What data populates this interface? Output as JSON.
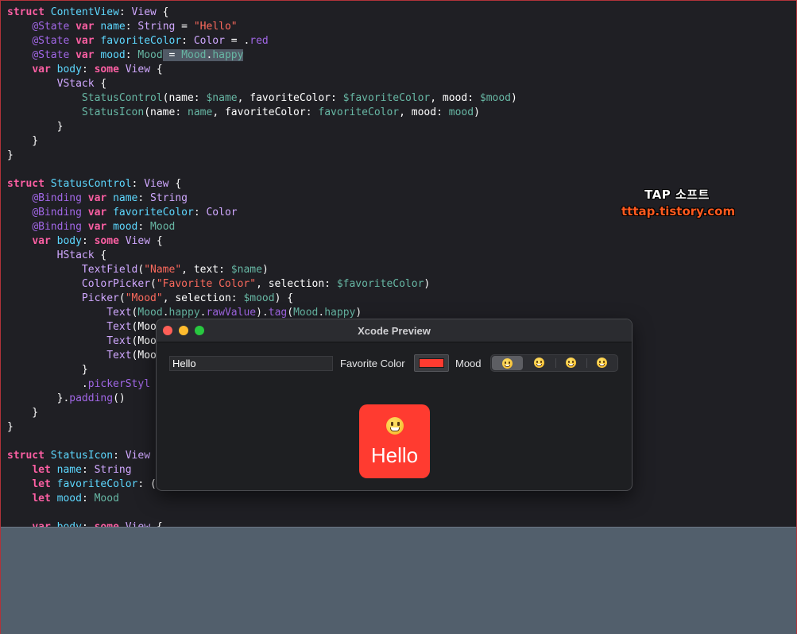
{
  "colors": {
    "keyword": "#fc5fa3",
    "type": "#5dd8ff",
    "property": "#67b7a4",
    "string": "#fc6a5d",
    "function": "#a167e6",
    "favorite_color": "#ff3b30",
    "bottom_panel": "#525f6c"
  },
  "code_lines": [
    [
      [
        "kw",
        "struct"
      ],
      [
        "pl",
        " "
      ],
      [
        "ty",
        "ContentView"
      ],
      [
        "pl",
        ": "
      ],
      [
        "ty2",
        "View"
      ],
      [
        "pl",
        " {"
      ]
    ],
    [
      [
        "pl",
        "    "
      ],
      [
        "fn",
        "@State"
      ],
      [
        "pl",
        " "
      ],
      [
        "kw",
        "var"
      ],
      [
        "pl",
        " "
      ],
      [
        "ty",
        "name"
      ],
      [
        "pl",
        ": "
      ],
      [
        "ty2",
        "String"
      ],
      [
        "pl",
        " = "
      ],
      [
        "str",
        "\"Hello\""
      ]
    ],
    [
      [
        "pl",
        "    "
      ],
      [
        "fn",
        "@State"
      ],
      [
        "pl",
        " "
      ],
      [
        "kw",
        "var"
      ],
      [
        "pl",
        " "
      ],
      [
        "ty",
        "favoriteColor"
      ],
      [
        "pl",
        ": "
      ],
      [
        "ty2",
        "Color"
      ],
      [
        "pl",
        " = ."
      ],
      [
        "fn",
        "red"
      ]
    ],
    [
      [
        "pl",
        "    "
      ],
      [
        "fn",
        "@State"
      ],
      [
        "pl",
        " "
      ],
      [
        "kw",
        "var"
      ],
      [
        "pl",
        " "
      ],
      [
        "ty",
        "mood"
      ],
      [
        "pl",
        ": "
      ],
      [
        "prop",
        "Mood"
      ],
      [
        "sel",
        " = "
      ],
      [
        "selprop",
        "Mood"
      ],
      [
        "sel",
        "."
      ],
      [
        "selprop2",
        "happy"
      ]
    ],
    [
      [
        "pl",
        "    "
      ],
      [
        "kw",
        "var"
      ],
      [
        "pl",
        " "
      ],
      [
        "ty",
        "body"
      ],
      [
        "pl",
        ": "
      ],
      [
        "kw",
        "some"
      ],
      [
        "pl",
        " "
      ],
      [
        "ty2",
        "View"
      ],
      [
        "pl",
        " {"
      ]
    ],
    [
      [
        "pl",
        "        "
      ],
      [
        "ty2",
        "VStack"
      ],
      [
        "pl",
        " {"
      ]
    ],
    [
      [
        "pl",
        "            "
      ],
      [
        "prop",
        "StatusControl"
      ],
      [
        "pl",
        "(name: "
      ],
      [
        "prop",
        "$name"
      ],
      [
        "pl",
        ", favoriteColor: "
      ],
      [
        "prop",
        "$favoriteColor"
      ],
      [
        "pl",
        ", mood: "
      ],
      [
        "prop",
        "$mood"
      ],
      [
        "pl",
        ")"
      ]
    ],
    [
      [
        "pl",
        "            "
      ],
      [
        "prop",
        "StatusIcon"
      ],
      [
        "pl",
        "(name: "
      ],
      [
        "prop",
        "name"
      ],
      [
        "pl",
        ", favoriteColor: "
      ],
      [
        "prop",
        "favoriteColor"
      ],
      [
        "pl",
        ", mood: "
      ],
      [
        "prop",
        "mood"
      ],
      [
        "pl",
        ")"
      ]
    ],
    [
      [
        "pl",
        "        }"
      ]
    ],
    [
      [
        "pl",
        "    }"
      ]
    ],
    [
      [
        "pl",
        "}"
      ]
    ],
    [
      [
        "pl",
        ""
      ]
    ],
    [
      [
        "kw",
        "struct"
      ],
      [
        "pl",
        " "
      ],
      [
        "ty",
        "StatusControl"
      ],
      [
        "pl",
        ": "
      ],
      [
        "ty2",
        "View"
      ],
      [
        "pl",
        " {"
      ]
    ],
    [
      [
        "pl",
        "    "
      ],
      [
        "fn",
        "@Binding"
      ],
      [
        "pl",
        " "
      ],
      [
        "kw",
        "var"
      ],
      [
        "pl",
        " "
      ],
      [
        "ty",
        "name"
      ],
      [
        "pl",
        ": "
      ],
      [
        "ty2",
        "String"
      ]
    ],
    [
      [
        "pl",
        "    "
      ],
      [
        "fn",
        "@Binding"
      ],
      [
        "pl",
        " "
      ],
      [
        "kw",
        "var"
      ],
      [
        "pl",
        " "
      ],
      [
        "ty",
        "favoriteColor"
      ],
      [
        "pl",
        ": "
      ],
      [
        "ty2",
        "Color"
      ]
    ],
    [
      [
        "pl",
        "    "
      ],
      [
        "fn",
        "@Binding"
      ],
      [
        "pl",
        " "
      ],
      [
        "kw",
        "var"
      ],
      [
        "pl",
        " "
      ],
      [
        "ty",
        "mood"
      ],
      [
        "pl",
        ": "
      ],
      [
        "prop",
        "Mood"
      ]
    ],
    [
      [
        "pl",
        "    "
      ],
      [
        "kw",
        "var"
      ],
      [
        "pl",
        " "
      ],
      [
        "ty",
        "body"
      ],
      [
        "pl",
        ": "
      ],
      [
        "kw",
        "some"
      ],
      [
        "pl",
        " "
      ],
      [
        "ty2",
        "View"
      ],
      [
        "pl",
        " {"
      ]
    ],
    [
      [
        "pl",
        "        "
      ],
      [
        "ty2",
        "HStack"
      ],
      [
        "pl",
        " {"
      ]
    ],
    [
      [
        "pl",
        "            "
      ],
      [
        "ty2",
        "TextField"
      ],
      [
        "pl",
        "("
      ],
      [
        "str",
        "\"Name\""
      ],
      [
        "pl",
        ", text: "
      ],
      [
        "prop",
        "$name"
      ],
      [
        "pl",
        ")"
      ]
    ],
    [
      [
        "pl",
        "            "
      ],
      [
        "ty2",
        "ColorPicker"
      ],
      [
        "pl",
        "("
      ],
      [
        "str",
        "\"Favorite Color\""
      ],
      [
        "pl",
        ", selection: "
      ],
      [
        "prop",
        "$favoriteColor"
      ],
      [
        "pl",
        ")"
      ]
    ],
    [
      [
        "pl",
        "            "
      ],
      [
        "ty2",
        "Picker"
      ],
      [
        "pl",
        "("
      ],
      [
        "str",
        "\"Mood\""
      ],
      [
        "pl",
        ", selection: "
      ],
      [
        "prop",
        "$mood"
      ],
      [
        "pl",
        ") {"
      ]
    ],
    [
      [
        "pl",
        "                "
      ],
      [
        "ty2",
        "Text"
      ],
      [
        "pl",
        "("
      ],
      [
        "prop",
        "Mood"
      ],
      [
        "pl",
        "."
      ],
      [
        "prop",
        "happy"
      ],
      [
        "pl",
        "."
      ],
      [
        "fn",
        "rawValue"
      ],
      [
        "pl",
        ")."
      ],
      [
        "fn",
        "tag"
      ],
      [
        "pl",
        "("
      ],
      [
        "prop",
        "Mood"
      ],
      [
        "pl",
        "."
      ],
      [
        "prop",
        "happy"
      ],
      [
        "pl",
        ")"
      ]
    ],
    [
      [
        "pl",
        "                "
      ],
      [
        "ty2",
        "Text"
      ],
      [
        "pl",
        "(Moo"
      ]
    ],
    [
      [
        "pl",
        "                "
      ],
      [
        "ty2",
        "Text"
      ],
      [
        "pl",
        "(Moo"
      ]
    ],
    [
      [
        "pl",
        "                "
      ],
      [
        "ty2",
        "Text"
      ],
      [
        "pl",
        "(Moo"
      ]
    ],
    [
      [
        "pl",
        "            }"
      ]
    ],
    [
      [
        "pl",
        "            ."
      ],
      [
        "fn",
        "pickerStyl"
      ]
    ],
    [
      [
        "pl",
        "        }."
      ],
      [
        "fn",
        "padding"
      ],
      [
        "pl",
        "()"
      ]
    ],
    [
      [
        "pl",
        "    }"
      ]
    ],
    [
      [
        "pl",
        "}"
      ]
    ],
    [
      [
        "pl",
        ""
      ]
    ],
    [
      [
        "kw",
        "struct"
      ],
      [
        "pl",
        " "
      ],
      [
        "ty",
        "StatusIcon"
      ],
      [
        "pl",
        ": "
      ],
      [
        "ty2",
        "View"
      ]
    ],
    [
      [
        "pl",
        "    "
      ],
      [
        "kw",
        "let"
      ],
      [
        "pl",
        " "
      ],
      [
        "ty",
        "name"
      ],
      [
        "pl",
        ": "
      ],
      [
        "ty2",
        "String"
      ]
    ],
    [
      [
        "pl",
        "    "
      ],
      [
        "kw",
        "let"
      ],
      [
        "pl",
        " "
      ],
      [
        "ty",
        "favoriteColor"
      ],
      [
        "pl",
        ": ("
      ]
    ],
    [
      [
        "pl",
        "    "
      ],
      [
        "kw",
        "let"
      ],
      [
        "pl",
        " "
      ],
      [
        "ty",
        "mood"
      ],
      [
        "pl",
        ": "
      ],
      [
        "prop",
        "Mood"
      ]
    ],
    [
      [
        "pl",
        ""
      ]
    ],
    [
      [
        "pl",
        "    "
      ],
      [
        "kw",
        "var"
      ],
      [
        "pl",
        " "
      ],
      [
        "ty",
        "body"
      ],
      [
        "pl",
        ": "
      ],
      [
        "kw",
        "some"
      ],
      [
        "pl",
        " "
      ],
      [
        "ty2",
        "View"
      ],
      [
        "pl",
        " {"
      ]
    ]
  ],
  "watermark": {
    "title": "TAP 소프트",
    "url": "tttap.tistory.com"
  },
  "preview": {
    "window_title": "Xcode Preview",
    "name_value": "Hello",
    "favorite_color_label": "Favorite Color",
    "mood_label": "Mood",
    "mood_options": [
      {
        "icon": "grinning-face-emoji",
        "selected": true
      },
      {
        "icon": "grinning-face-emoji",
        "selected": false
      },
      {
        "icon": "grinning-face-emoji",
        "selected": false
      },
      {
        "icon": "grinning-face-emoji",
        "selected": false
      }
    ],
    "status_icon": {
      "emoji": "grinning-face-emoji",
      "name": "Hello"
    }
  }
}
